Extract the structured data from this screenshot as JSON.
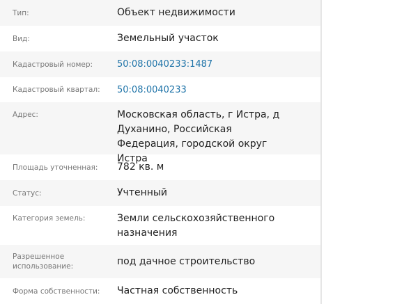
{
  "colors": {
    "link": "#1e73a8",
    "alt_row": "#f6f6f6"
  },
  "rows": [
    {
      "label": "Тип:",
      "value": "Объект недвижимости"
    },
    {
      "label": "Вид:",
      "value": "Земельный участок"
    },
    {
      "label": "Кадастровый номер:",
      "value": "50:08:0040233:1487"
    },
    {
      "label": "Кадастровый квартал:",
      "value": "50:08:0040233"
    },
    {
      "label": "Адрес:",
      "value": "Московская область, г Истра, д Духанино, Российская Федерация, городской округ Истра"
    },
    {
      "label": "Площадь уточненная:",
      "value": "782 кв. м"
    },
    {
      "label": "Статус:",
      "value": "Учтенный"
    },
    {
      "label": "Категория земель:",
      "value": "Земли сельскохозяйственного назначения"
    },
    {
      "label": "Разрешенное использование:",
      "value": "под дачное строительство"
    },
    {
      "label": "Форма собственности:",
      "value": "Частная собственность"
    }
  ]
}
